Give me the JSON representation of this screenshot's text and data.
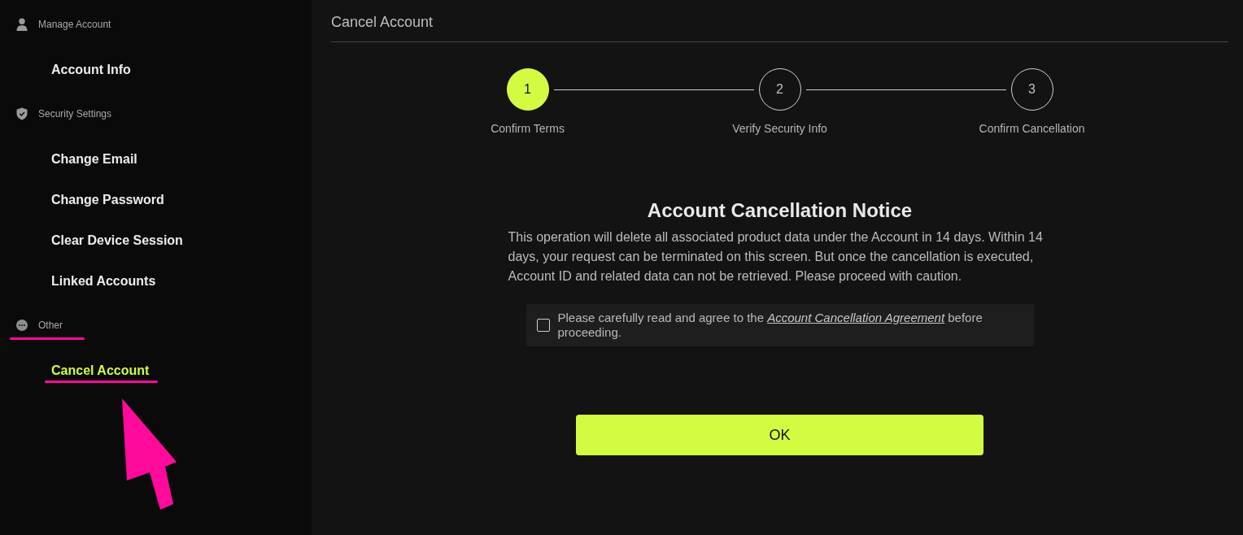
{
  "sidebar": {
    "sections": [
      {
        "kind": "person",
        "label": "Manage Account",
        "underlined": false,
        "items": [
          {
            "label": "Account Info",
            "selected": false,
            "underlined": false,
            "pointed_at": false
          }
        ]
      },
      {
        "kind": "shield",
        "label": "Security Settings",
        "underlined": false,
        "items": [
          {
            "label": "Change Email",
            "selected": false,
            "underlined": false,
            "pointed_at": false
          },
          {
            "label": "Change Password",
            "selected": false,
            "underlined": false,
            "pointed_at": false
          },
          {
            "label": "Clear Device Session",
            "selected": false,
            "underlined": false,
            "pointed_at": false
          },
          {
            "label": "Linked Accounts",
            "selected": false,
            "underlined": false,
            "pointed_at": false
          }
        ]
      },
      {
        "kind": "more",
        "label": "Other",
        "underlined": true,
        "items": [
          {
            "label": "Cancel Account",
            "selected": true,
            "underlined": true,
            "pointed_at": true
          }
        ]
      }
    ]
  },
  "page": {
    "title": "Cancel Account"
  },
  "steps": [
    {
      "number": "1",
      "label": "Confirm Terms",
      "current": true
    },
    {
      "number": "2",
      "label": "Verify Security Info",
      "current": false
    },
    {
      "number": "3",
      "label": "Confirm Cancellation",
      "current": false
    }
  ],
  "notice": {
    "title": "Account Cancellation Notice",
    "body": "This operation will delete all associated product data under the Account in 14 days. Within 14 days, your request can be terminated on this screen. But once the cancellation is executed, Account ID and related data can not be retrieved. Please proceed with caution.",
    "agreement": {
      "checked": false,
      "text_before": "Please carefully read and agree to the ",
      "link": "Account Cancellation Agreement",
      "text_after": " before proceeding."
    }
  },
  "buttons": [
    {
      "label": "OK"
    }
  ]
}
